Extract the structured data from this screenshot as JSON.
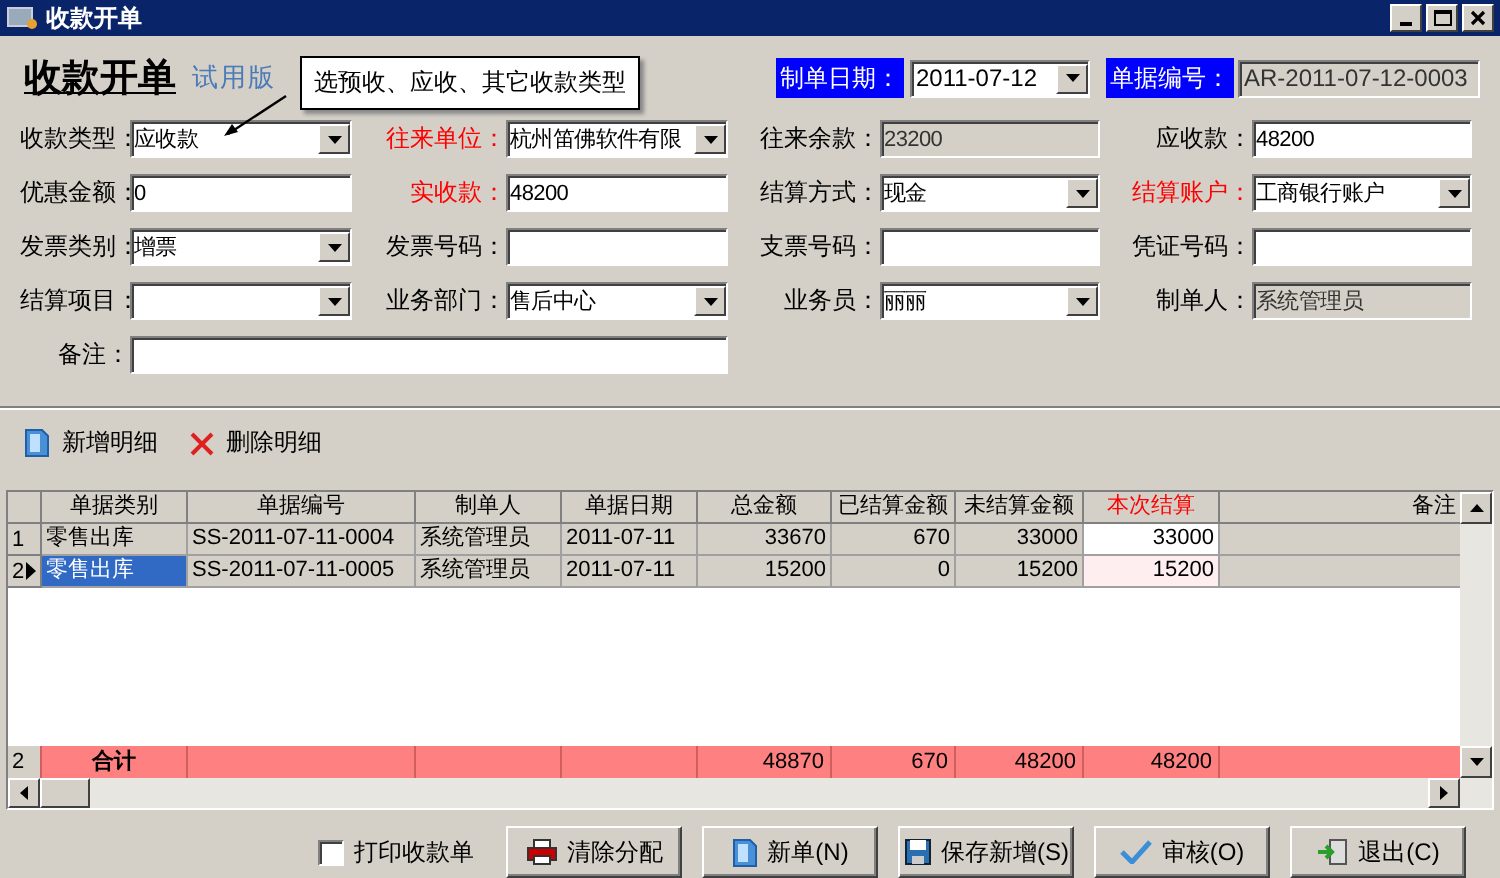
{
  "window": {
    "title": "收款开单",
    "controls": [
      {
        "kind": "minimize"
      },
      {
        "kind": "maximize"
      },
      {
        "kind": "close"
      }
    ]
  },
  "header": {
    "title": "收款开单",
    "edition": "试用版",
    "tooltip": "选预收、应收、其它收款类型",
    "date": {
      "label": "制单日期：",
      "value": "2011-07-12"
    },
    "number": {
      "label": "单据编号：",
      "value": "AR-2011-07-12-0003"
    }
  },
  "fields": [
    {
      "label": "收款类型：",
      "kind": "dropdown",
      "value": "应收款",
      "required": false
    },
    {
      "label": "往来单位：",
      "kind": "dropdown",
      "value": "杭州笛佛软件有限",
      "required": true
    },
    {
      "label": "往来余款：",
      "kind": "readonly",
      "value": "23200",
      "required": false
    },
    {
      "label": "应收款：",
      "kind": "text",
      "value": "48200",
      "required": false
    },
    {
      "label": "优惠金额：",
      "kind": "text",
      "value": "0",
      "required": false
    },
    {
      "label": "实收款：",
      "kind": "text",
      "value": "48200",
      "required": true
    },
    {
      "label": "结算方式：",
      "kind": "dropdown",
      "value": "现金",
      "required": false
    },
    {
      "label": "结算账户：",
      "kind": "dropdown",
      "value": "工商银行账户",
      "required": true
    },
    {
      "label": "发票类别：",
      "kind": "dropdown",
      "value": "增票",
      "required": false
    },
    {
      "label": "发票号码：",
      "kind": "text",
      "required": false
    },
    {
      "label": "支票号码：",
      "kind": "text",
      "required": false
    },
    {
      "label": "凭证号码：",
      "kind": "text",
      "required": false
    },
    {
      "label": "结算项目：",
      "kind": "dropdown",
      "required": false
    },
    {
      "label": "业务部门：",
      "kind": "dropdown",
      "value": "售后中心",
      "required": false
    },
    {
      "label": "业务员：",
      "kind": "dropdown",
      "value": "丽丽",
      "required": false
    },
    {
      "label": "制单人：",
      "kind": "readonly",
      "value": "系统管理员",
      "required": false
    },
    {
      "label": "备注：",
      "kind": "memo",
      "required": false
    }
  ],
  "toolbar": [
    {
      "kind": "add",
      "label": "新增明细"
    },
    {
      "kind": "delete",
      "label": "删除明细"
    }
  ],
  "table": {
    "columns": [
      {
        "label": "单据类别",
        "required": false
      },
      {
        "label": "单据编号",
        "required": false
      },
      {
        "label": "制单人",
        "required": false
      },
      {
        "label": "单据日期",
        "required": false
      },
      {
        "label": "总金额",
        "required": false
      },
      {
        "label": "已结算金额",
        "required": false
      },
      {
        "label": "未结算金额",
        "required": false
      },
      {
        "label": "本次结算",
        "required": true
      },
      {
        "label": "备注",
        "required": false
      }
    ],
    "rows": [
      {
        "number": "1",
        "selected": false,
        "cells": [
          "零售出库",
          "SS-2011-07-11-0004",
          "系统管理员",
          "2011-07-11",
          "33670",
          "670",
          "33000",
          "33000"
        ]
      },
      {
        "number": "2",
        "selected": true,
        "cells": [
          "零售出库",
          "SS-2011-07-11-0005",
          "系统管理员",
          "2011-07-11",
          "15200",
          "0",
          "15200",
          "15200"
        ]
      }
    ],
    "totals": {
      "number": "2",
      "label": "合计",
      "values": [
        "48870",
        "670",
        "48200",
        "48200"
      ]
    }
  },
  "footer": {
    "checkbox": {
      "label": "打印收款单",
      "checked": false
    },
    "buttons": [
      {
        "kind": "printer",
        "label": "清除分配"
      },
      {
        "kind": "document",
        "label": "新单(N)"
      },
      {
        "kind": "save",
        "label": "保存新增(S)"
      },
      {
        "kind": "check",
        "label": "审核(O)"
      },
      {
        "kind": "exit",
        "label": "退出(C)"
      }
    ]
  }
}
